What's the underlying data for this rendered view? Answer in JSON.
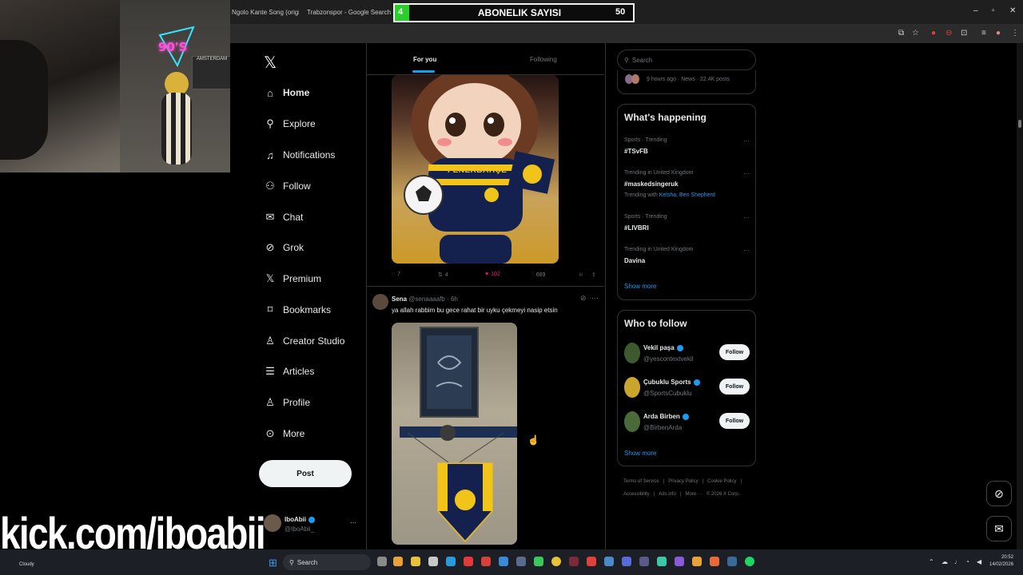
{
  "browser": {
    "tabs": [
      {
        "title": "Ngolo Kante Song (origi",
        "close": "×"
      },
      {
        "title": "Trabzonspor - Google Search",
        "close": "×"
      }
    ],
    "window_controls": [
      "–",
      "▫",
      "✕"
    ]
  },
  "subscriber_bar": {
    "label": "ABONELIK SAYISI",
    "current": "4",
    "target": "50",
    "fill_fraction": 0.08,
    "fill_color": "#2bcf2b"
  },
  "webcam": {
    "neon_sign": "90'S",
    "poster": "AMSTERDAM"
  },
  "overlay": {
    "kick_url": "kick.com/iboabii"
  },
  "sidebar": {
    "logo": "𝕏",
    "items": [
      {
        "label": "Home",
        "icon": "home-icon"
      },
      {
        "label": "Explore",
        "icon": "search-icon"
      },
      {
        "label": "Notifications",
        "icon": "bell-icon"
      },
      {
        "label": "Follow",
        "icon": "add-person-icon"
      },
      {
        "label": "Chat",
        "icon": "mail-icon"
      },
      {
        "label": "Grok",
        "icon": "grok-icon"
      },
      {
        "label": "Premium",
        "icon": "x-logo-icon"
      },
      {
        "label": "Bookmarks",
        "icon": "bookmark-icon"
      },
      {
        "label": "Creator Studio",
        "icon": "creator-icon"
      },
      {
        "label": "Articles",
        "icon": "article-icon"
      },
      {
        "label": "Profile",
        "icon": "person-icon"
      },
      {
        "label": "More",
        "icon": "more-circle-icon"
      }
    ],
    "post_button": "Post",
    "account": {
      "name": "IboAbii",
      "handle": "@IboAbii_",
      "menu": "···"
    }
  },
  "feed": {
    "tabs": {
      "for_you": "For you",
      "following": "Following"
    },
    "post1": {
      "image_text": "FENERBAHÇE",
      "replies": "7",
      "reposts": "4",
      "likes": "102",
      "views": "689",
      "like_color": "#f91880"
    },
    "post2": {
      "author": "Sena",
      "handle": "@senaaaafb",
      "time": "· 6h",
      "text": "ya allah rabbim bu gece rahat bir uyku çekmeyi nasip etsin"
    }
  },
  "right": {
    "search_placeholder": "Search",
    "news_meta": "9 hours ago · News · 22.4K posts",
    "whats_happening": {
      "title": "What's happening",
      "trends": [
        {
          "meta": "Sports · Trending",
          "tag": "#TSvFB"
        },
        {
          "meta": "Trending in United Kingdom",
          "tag": "#maskedsingeruk",
          "with_prefix": "Trending with",
          "with": "Kelsha, Ben Shepherd"
        },
        {
          "meta": "Sports · Trending",
          "tag": "#LIVBRI"
        },
        {
          "meta": "Trending in United Kingdom",
          "tag": "Davina"
        }
      ],
      "show_more": "Show more"
    },
    "who_to_follow": {
      "title": "Who to follow",
      "accounts": [
        {
          "name": "Vekil paşa",
          "handle": "@yescontextvekil",
          "button": "Follow"
        },
        {
          "name": "Çubuklu Sports",
          "handle": "@SportsCubuklu",
          "button": "Follow"
        },
        {
          "name": "Arda Birben",
          "handle": "@BirbenArda",
          "button": "Follow"
        }
      ],
      "show_more": "Show more"
    },
    "footer": {
      "row1": [
        "Terms of Service",
        "|",
        "Privacy Policy",
        "|",
        "Cookie Policy",
        "|"
      ],
      "row2": [
        "Accessibility",
        "|",
        "Ads info",
        "|",
        "More ···",
        "© 2026 X Corp."
      ]
    }
  },
  "taskbar": {
    "search": "Search",
    "weather": "Cloudy",
    "time": "20:52",
    "date": "14/02/2026"
  }
}
